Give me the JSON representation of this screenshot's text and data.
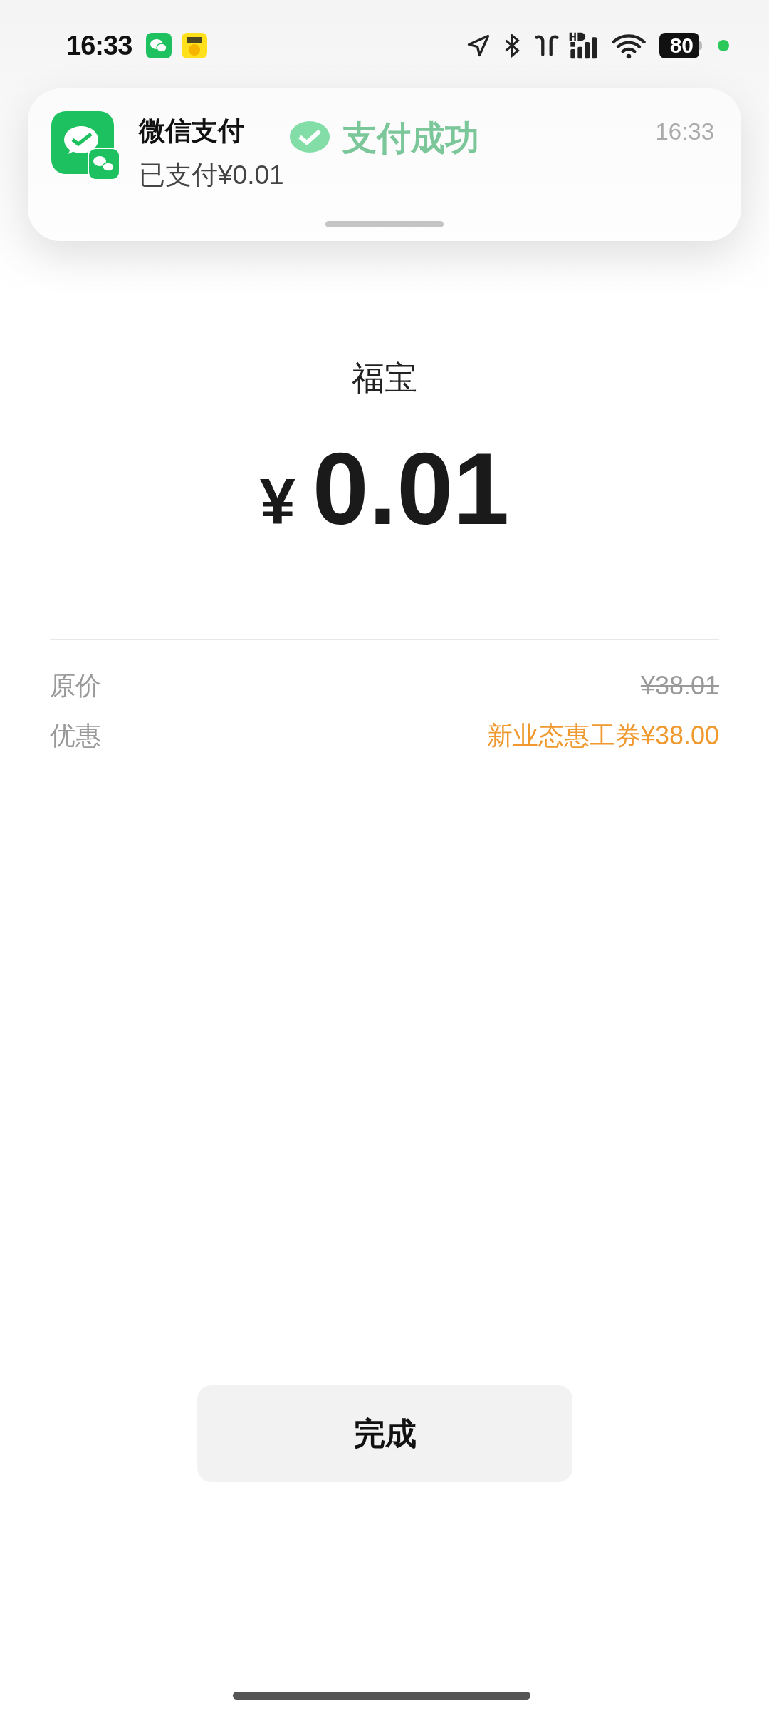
{
  "status_bar": {
    "time": "16:33",
    "battery": "80"
  },
  "header": {
    "title": "支付成功"
  },
  "notification": {
    "app": "微信支付",
    "message": "已支付¥0.01",
    "time": "16:33"
  },
  "payment": {
    "merchant": "福宝",
    "currency": "¥",
    "amount": "0.01"
  },
  "details": [
    {
      "label": "原价",
      "value": "¥38.01",
      "kind": "struck"
    },
    {
      "label": "优惠",
      "value": "新业态惠工券¥38.00",
      "kind": "discount"
    }
  ],
  "done_button": {
    "label": "完成"
  }
}
